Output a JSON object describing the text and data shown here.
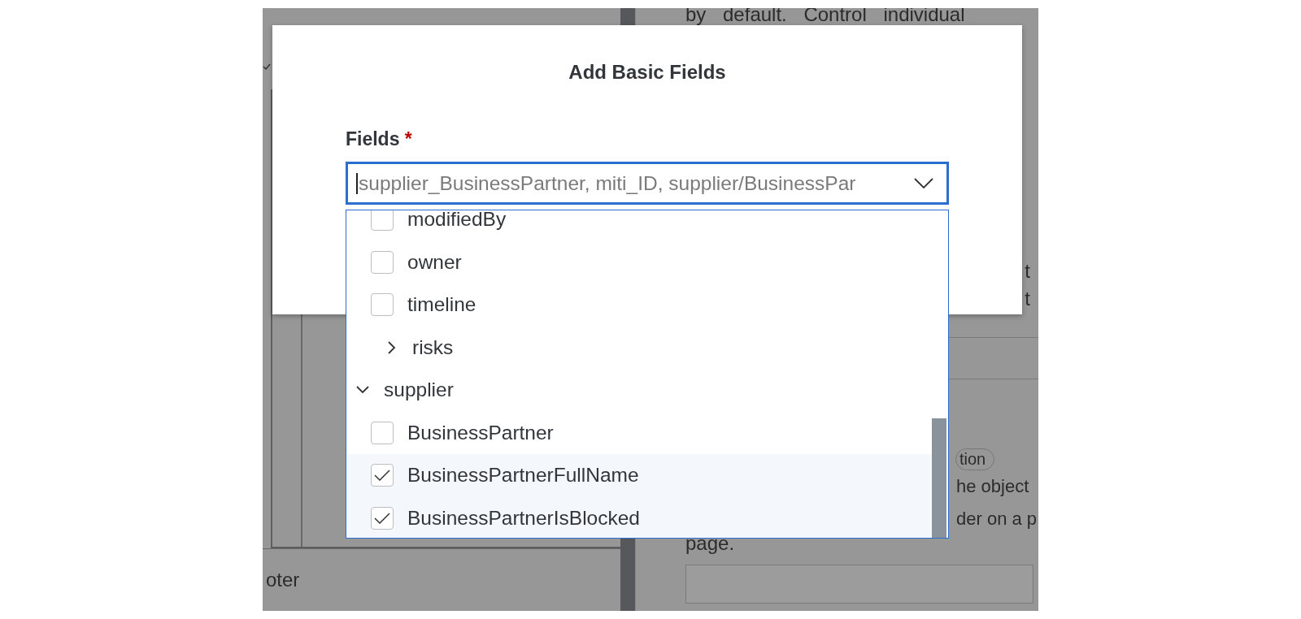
{
  "backdrop": {
    "left_panel": {
      "footer_text": "oter"
    },
    "right_panel": {
      "top_text": "by default. Control individual",
      "fragments": [
        "t",
        "t"
      ],
      "tag": "tion",
      "lines": [
        "he object",
        "der on a p"
      ],
      "text_below": "page."
    }
  },
  "dialog": {
    "title": "Add Basic Fields",
    "field_label": "Fields",
    "required_mark": "*",
    "value": "supplier_BusinessPartner, miti_ID, supplier/BusinessPar"
  },
  "tree": [
    {
      "children": [
        {
          "kind": "checkbox",
          "label": "modifiedBy",
          "checked": false
        },
        {
          "kind": "checkbox",
          "label": "owner",
          "checked": false
        },
        {
          "kind": "checkbox",
          "label": "timeline",
          "checked": false
        },
        {
          "kind": "group",
          "label": "risks",
          "expanded": false
        }
      ]
    },
    {
      "kind": "group",
      "label": "supplier",
      "expanded": true,
      "children": [
        {
          "kind": "checkbox",
          "label": "BusinessPartner",
          "checked": false
        },
        {
          "kind": "checkbox",
          "label": "BusinessPartnerFullName",
          "checked": true
        },
        {
          "kind": "checkbox",
          "label": "BusinessPartnerIsBlocked",
          "checked": true
        }
      ]
    }
  ]
}
